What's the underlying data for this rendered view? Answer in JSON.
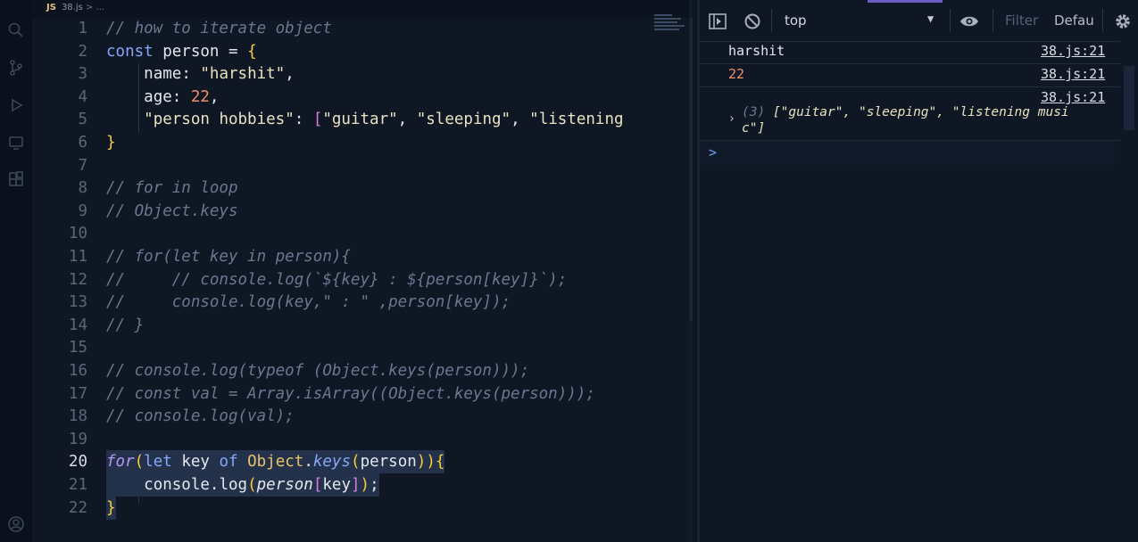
{
  "editor": {
    "breadcrumb": {
      "lang_badge": "JS",
      "file": "38.js",
      "separator": ">",
      "more": "..."
    },
    "current_line": "20",
    "lines": [
      {
        "num": "1",
        "text": "// how to iterate object"
      },
      {
        "num": "2",
        "text": "const person = {"
      },
      {
        "num": "3",
        "text": "    name: \"harshit\","
      },
      {
        "num": "4",
        "text": "    age: 22,"
      },
      {
        "num": "5",
        "text": "    \"person hobbies\": [\"guitar\", \"sleeping\", \"listening"
      },
      {
        "num": "6",
        "text": "}"
      },
      {
        "num": "7",
        "text": ""
      },
      {
        "num": "8",
        "text": "// for in loop"
      },
      {
        "num": "9",
        "text": "// Object.keys"
      },
      {
        "num": "10",
        "text": ""
      },
      {
        "num": "11",
        "text": "// for(let key in person){"
      },
      {
        "num": "12",
        "text": "//     // console.log(`${key} : ${person[key]}`);"
      },
      {
        "num": "13",
        "text": "//     console.log(key,\" : \" ,person[key]);"
      },
      {
        "num": "14",
        "text": "// }"
      },
      {
        "num": "15",
        "text": ""
      },
      {
        "num": "16",
        "text": "// console.log(typeof (Object.keys(person)));"
      },
      {
        "num": "17",
        "text": "// const val = Array.isArray((Object.keys(person)));"
      },
      {
        "num": "18",
        "text": "// console.log(val);"
      },
      {
        "num": "19",
        "text": ""
      },
      {
        "num": "20",
        "text": "for(let key of Object.keys(person)){"
      },
      {
        "num": "21",
        "text": "    console.log(person[key]);"
      },
      {
        "num": "22",
        "text": "}"
      }
    ]
  },
  "devtools": {
    "context": "top",
    "filter_placeholder": "Filter",
    "levels_label": "Defau",
    "messages": [
      {
        "text": "harshit",
        "source": "38.js:21"
      },
      {
        "text": "22",
        "source": "38.js:21"
      },
      {
        "source": "38.js:21",
        "array_count": "(3)",
        "array_line1": " [\"guitar\", \"sleeping\", \"listening musi",
        "array_line2": "c\"]"
      }
    ],
    "prompt_symbol": ">"
  },
  "colors": {
    "background": "#0f1724",
    "keyword": "#86a7f7",
    "number": "#f39268",
    "brace": "#f7cf3d",
    "comment": "#6b7790"
  }
}
